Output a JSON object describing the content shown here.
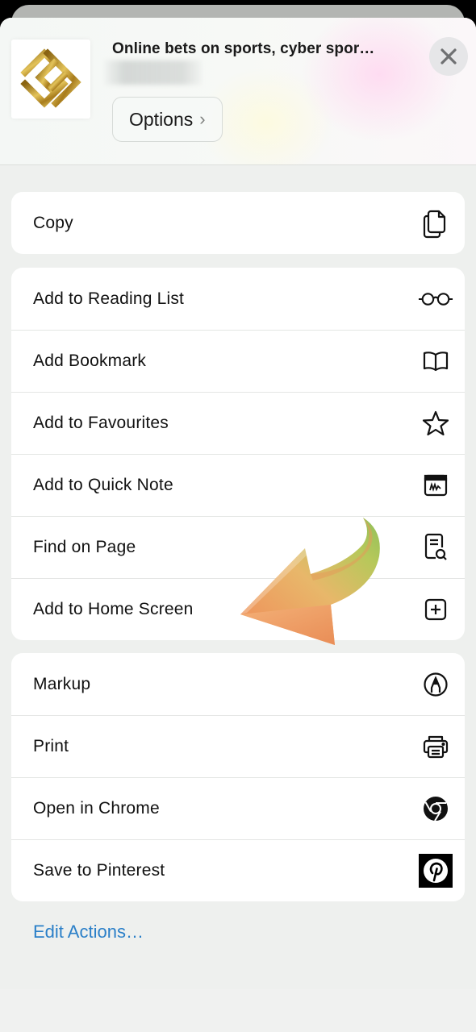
{
  "share_sheet": {
    "site_title": "Online bets on sports, cyber spor…",
    "url_hidden": true,
    "options_label": "Options",
    "options_chevron": "›",
    "close_icon": "close-icon",
    "app_icon": "gold-diamond-logo-icon"
  },
  "groups": [
    {
      "items": [
        {
          "label": "Copy",
          "icon": "copy-icon"
        }
      ]
    },
    {
      "items": [
        {
          "label": "Add to Reading List",
          "icon": "glasses-icon"
        },
        {
          "label": "Add Bookmark",
          "icon": "book-icon"
        },
        {
          "label": "Add to Favourites",
          "icon": "star-icon"
        },
        {
          "label": "Add to Quick Note",
          "icon": "quick-note-icon"
        },
        {
          "label": "Find on Page",
          "icon": "find-on-page-icon"
        },
        {
          "label": "Add to Home Screen",
          "icon": "add-square-icon"
        }
      ]
    },
    {
      "items": [
        {
          "label": "Markup",
          "icon": "markup-pen-icon"
        },
        {
          "label": "Print",
          "icon": "printer-icon"
        },
        {
          "label": "Open in Chrome",
          "icon": "chrome-icon"
        },
        {
          "label": "Save to Pinterest",
          "icon": "pinterest-icon"
        }
      ]
    }
  ],
  "edit_actions_label": "Edit Actions…",
  "colors": {
    "link_blue": "#2a7fc8",
    "sheet_bg": "#eef0ee",
    "arrow_orange": "#ee9a5e",
    "arrow_green": "#9cc25a"
  },
  "annotation": {
    "arrow_points_to": "Add to Home Screen"
  }
}
